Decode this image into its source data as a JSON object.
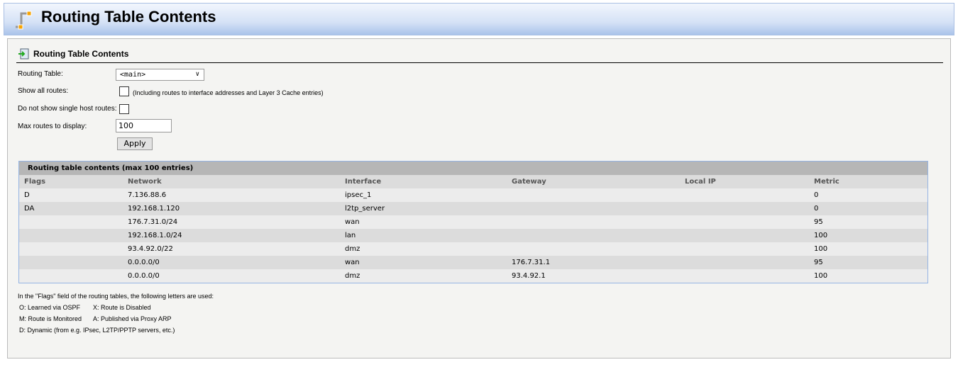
{
  "header": {
    "title": "Routing Table Contents"
  },
  "section": {
    "title": "Routing Table Contents"
  },
  "form": {
    "routing_table_label": "Routing Table:",
    "routing_table_value": "<main>",
    "show_all_label": "Show all routes:",
    "show_all_note": "(Including routes to interface addresses and Layer 3 Cache entries)",
    "single_host_label": "Do not show single host routes:",
    "max_routes_label": "Max routes to display:",
    "max_routes_value": "100",
    "apply_label": "Apply"
  },
  "table": {
    "title": "Routing table contents (max 100 entries)",
    "columns": [
      "Flags",
      "Network",
      "Interface",
      "Gateway",
      "Local IP",
      "Metric"
    ],
    "rows": [
      [
        "D",
        "7.136.88.6",
        "ipsec_1",
        "",
        "",
        "0"
      ],
      [
        "DA",
        "192.168.1.120",
        "l2tp_server",
        "",
        "",
        "0"
      ],
      [
        "",
        "176.7.31.0/24",
        "wan",
        "",
        "",
        "95"
      ],
      [
        "",
        "192.168.1.0/24",
        "lan",
        "",
        "",
        "100"
      ],
      [
        "",
        "93.4.92.0/22",
        "dmz",
        "",
        "",
        "100"
      ],
      [
        "",
        "0.0.0.0/0",
        "wan",
        "176.7.31.1",
        "",
        "95"
      ],
      [
        "",
        "0.0.0.0/0",
        "dmz",
        "93.4.92.1",
        "",
        "100"
      ]
    ]
  },
  "legend": {
    "intro": "In the \"Flags\" field of the routing tables, the following letters are used:",
    "o": "O: Learned via OSPF",
    "x": "X: Route is Disabled",
    "m": "M: Route is Monitored",
    "a": "A: Published via Proxy ARP",
    "d": "D: Dynamic (from e.g. IPsec, L2TP/PPTP servers, etc.)"
  }
}
